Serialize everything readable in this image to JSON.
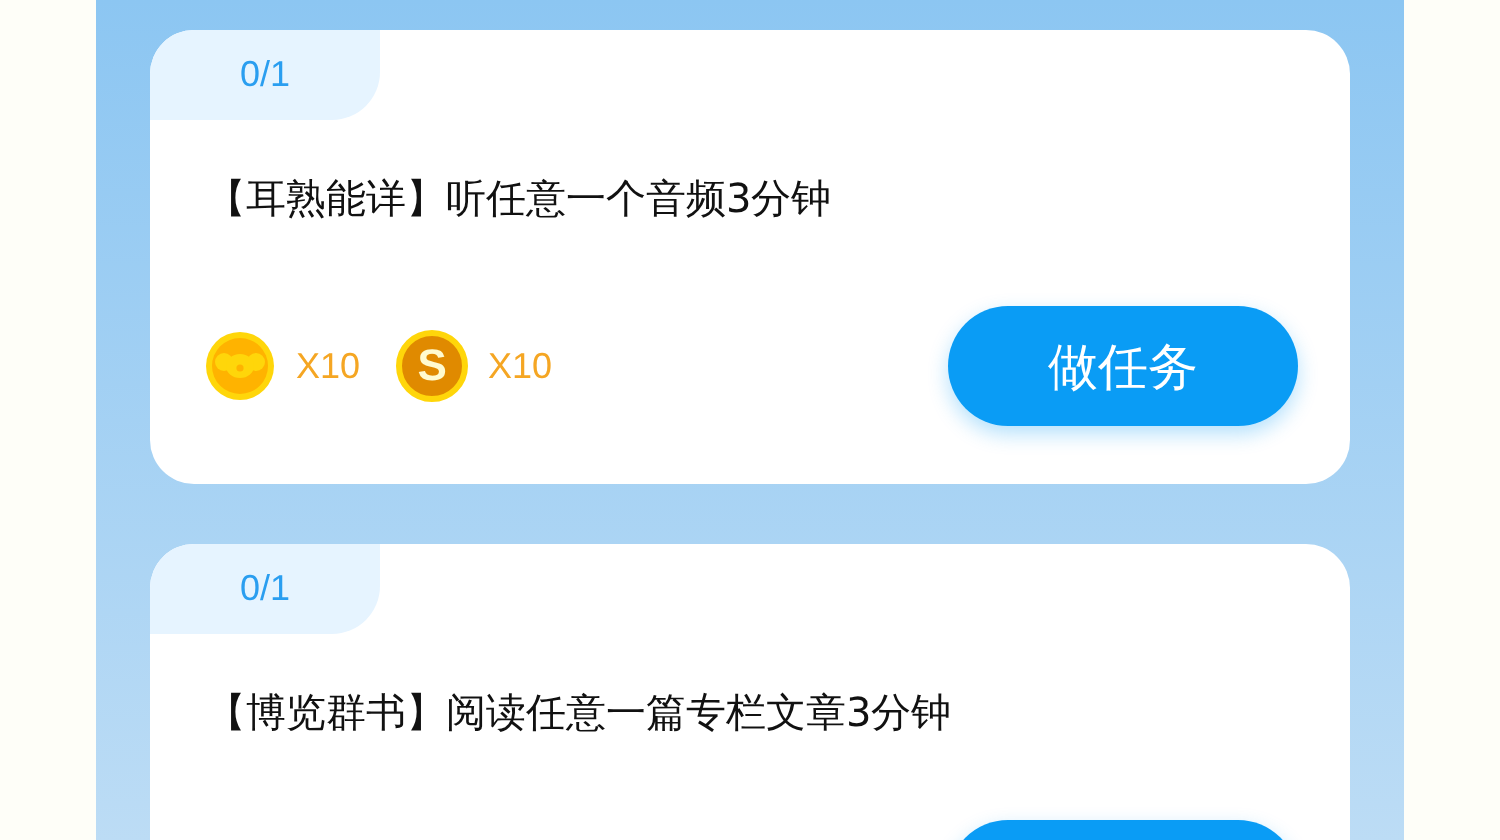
{
  "tasks": [
    {
      "progress": "0/1",
      "title": "【耳熟能详】听任意一个音频3分钟",
      "rewards": [
        {
          "kind": "koala",
          "amount": "X10"
        },
        {
          "kind": "letter",
          "symbol": "S",
          "amount": "X10"
        }
      ],
      "button": "做任务"
    },
    {
      "progress": "0/1",
      "title": "【博览群书】阅读任意一篇专栏文章3分钟"
    }
  ]
}
